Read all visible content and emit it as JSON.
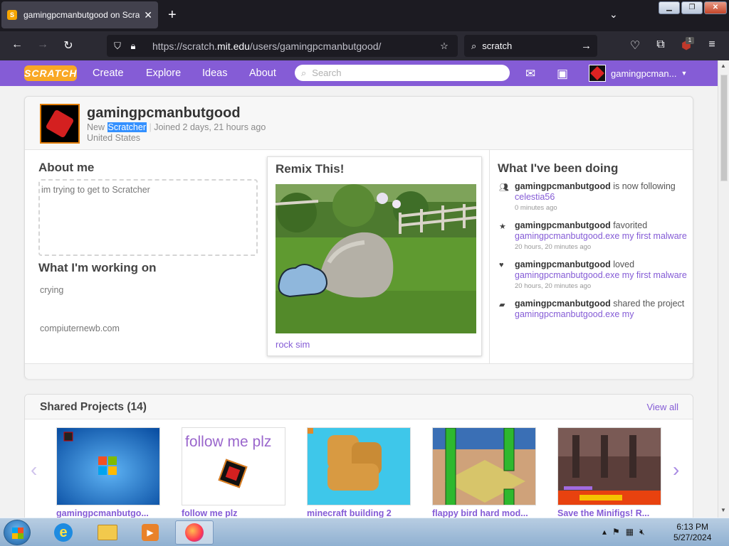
{
  "browser": {
    "tab_title": "gamingpcmanbutgood on Scratch",
    "url_prefix": "https://scratch.",
    "url_domain": "mit.edu",
    "url_path": "/users/gamingpcmanbutgood/",
    "search_value": "scratch",
    "extension_badge": "1"
  },
  "scratch_header": {
    "logo": "SCRATCH",
    "nav": [
      "Create",
      "Explore",
      "Ideas",
      "About"
    ],
    "search_placeholder": "Search",
    "username": "gamingpcman...",
    "accent_color": "#855cd6"
  },
  "profile": {
    "username": "gamingpcmanbutgood",
    "role_prefix": "New",
    "role": "Scratcher",
    "joined": "Joined 2 days, 21 hours ago",
    "location": "United States",
    "about_title": "About me",
    "about_text": "im trying to get to Scratcher",
    "working_title": "What I'm working on",
    "working_text": "crying",
    "working_text2": "compiuternewb.com"
  },
  "remix": {
    "title": "Remix This!",
    "project_title": "rock sim"
  },
  "activity": {
    "title": "What I've been doing",
    "items": [
      {
        "icon": "follow-icon",
        "user": "gamingpcmanbutgood",
        "action": "is now following",
        "target": "celestia56",
        "time": "0 minutes ago"
      },
      {
        "icon": "star-icon",
        "user": "gamingpcmanbutgood",
        "action": "favorited",
        "target": "gamingpcmanbutgood.exe my first malware",
        "time": "20 hours, 20 minutes ago"
      },
      {
        "icon": "heart-icon",
        "user": "gamingpcmanbutgood",
        "action": "loved",
        "target": "gamingpcmanbutgood.exe my first malware",
        "time": "20 hours, 20 minutes ago"
      },
      {
        "icon": "share-icon",
        "user": "gamingpcmanbutgood",
        "action": "shared the project",
        "target": "gamingpcmanbutgood.exe my",
        "time": ""
      }
    ]
  },
  "shared_projects": {
    "title": "Shared Projects (14)",
    "view_all": "View all",
    "projects": [
      {
        "title": "gamingpcmanbutgo..."
      },
      {
        "title": "follow me plz",
        "thumb_text": "follow me plz"
      },
      {
        "title": "minecraft building 2"
      },
      {
        "title": "flappy bird hard mod..."
      },
      {
        "title": "Save the Minifigs! R..."
      }
    ]
  },
  "taskbar": {
    "time": "6:13 PM",
    "date": "5/27/2024"
  }
}
